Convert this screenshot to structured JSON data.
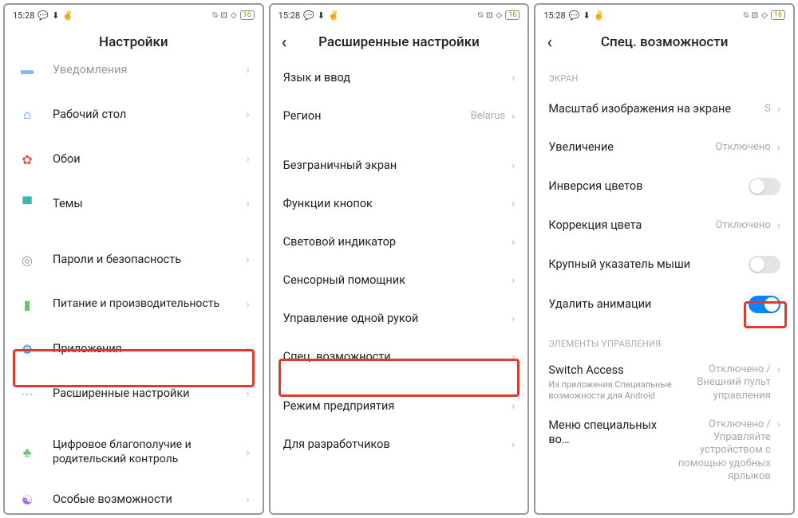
{
  "status": {
    "time": "15:28",
    "battery": "16"
  },
  "screen1": {
    "title": "Настройки",
    "rows": [
      {
        "label": "Уведомления"
      },
      {
        "label": "Рабочий стол"
      },
      {
        "label": "Обои"
      },
      {
        "label": "Темы"
      },
      {
        "label": "Пароли и безопасность"
      },
      {
        "label": "Питание и производительность"
      },
      {
        "label": "Приложения"
      },
      {
        "label": "Расширенные настройки"
      },
      {
        "label": "Цифровое благополучие и родительский контроль"
      },
      {
        "label": "Особые возможности"
      }
    ]
  },
  "screen2": {
    "title": "Расширенные настройки",
    "rows": [
      {
        "label": "Язык и ввод"
      },
      {
        "label": "Регион",
        "value": "Belarus"
      },
      {
        "label": "Безграничный экран"
      },
      {
        "label": "Функции кнопок"
      },
      {
        "label": "Световой индикатор"
      },
      {
        "label": "Сенсорный помощник"
      },
      {
        "label": "Управление одной рукой"
      },
      {
        "label": "Спец. возможности"
      },
      {
        "label": "Режим предприятия"
      },
      {
        "label": "Для разработчиков"
      }
    ]
  },
  "screen3": {
    "title": "Спец. возможности",
    "section1": "ЭКРАН",
    "section2": "ЭЛЕМЕНТЫ УПРАВЛЕНИЯ",
    "rows": [
      {
        "label": "Масштаб изображения на экране",
        "value": "S"
      },
      {
        "label": "Увеличение",
        "value": "Отключено"
      },
      {
        "label": "Инверсия цветов"
      },
      {
        "label": "Коррекция цвета",
        "value": "Отключено"
      },
      {
        "label": "Крупный указатель мыши"
      },
      {
        "label": "Удалить анимации"
      },
      {
        "label": "Switch Access",
        "sub": "Из приложения Специальные возможности для Android",
        "value": "Отключено / Внешний пульт управления"
      },
      {
        "label": "Меню специальных во…",
        "value": "Отключено / Управляйте устройством с помощью удобных ярлыков"
      }
    ]
  }
}
